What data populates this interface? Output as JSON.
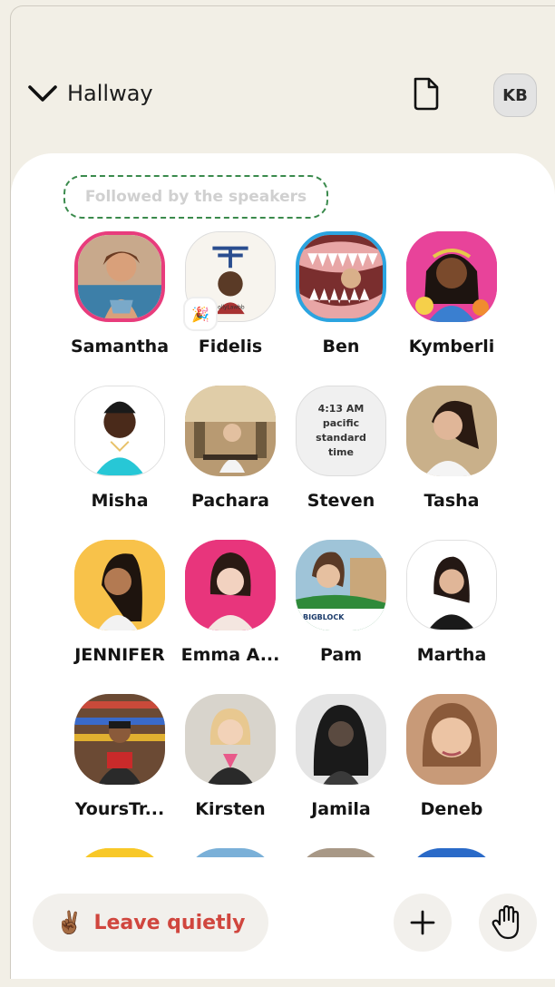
{
  "room": {
    "title": "Hallway",
    "user_initials": "KB"
  },
  "section_label": "Followed by the speakers",
  "people": [
    {
      "name": "Samantha"
    },
    {
      "name": "Fidelis"
    },
    {
      "name": "Ben"
    },
    {
      "name": "Kymberli"
    },
    {
      "name": "Misha"
    },
    {
      "name": "Pachara"
    },
    {
      "name": "Steven"
    },
    {
      "name": "Tasha"
    },
    {
      "name": "JENNIFER"
    },
    {
      "name": "Emma A..."
    },
    {
      "name": "Pam"
    },
    {
      "name": "Martha"
    },
    {
      "name": "YoursTr..."
    },
    {
      "name": "Kirsten"
    },
    {
      "name": "Jamila"
    },
    {
      "name": "Deneb"
    }
  ],
  "time_card": {
    "line1": "4:13 AM",
    "line2": "pacific",
    "line3": "standard",
    "line4": "time"
  },
  "bottom": {
    "leave_emoji": "✌🏾",
    "leave_label": "Leave quietly"
  },
  "colors": {
    "accent_red": "#d0463e",
    "pink_ring": "#e83c7c",
    "blue_ring": "#2ba4e0",
    "background": "#f2efe6"
  }
}
